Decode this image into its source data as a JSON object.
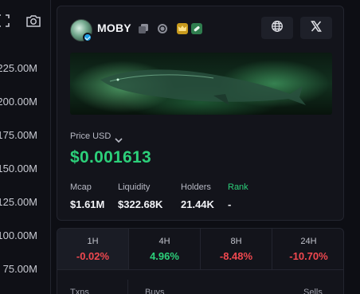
{
  "chart_axis": {
    "labels": [
      "225.00M",
      "200.00M",
      "175.00M",
      "150.00M",
      "125.00M",
      "100.00M",
      "75.00M"
    ]
  },
  "token": {
    "name": "MOBY",
    "price_label": "Price USD",
    "price": "$0.001613",
    "stats": [
      {
        "label": "Mcap",
        "value": "$1.61M"
      },
      {
        "label": "Liquidity",
        "value": "$322.68K"
      },
      {
        "label": "Holders",
        "value": "21.44K"
      },
      {
        "label": "Rank",
        "value": "-"
      }
    ],
    "icons": [
      "copy-icon",
      "search-icon",
      "crown-icon",
      "pill-icon",
      "globe-icon",
      "x-icon"
    ]
  },
  "changes": [
    {
      "period": "1H",
      "value": "-0.02%",
      "direction": "down"
    },
    {
      "period": "4H",
      "value": "4.96%",
      "direction": "up"
    },
    {
      "period": "8H",
      "value": "-8.48%",
      "direction": "down"
    },
    {
      "period": "24H",
      "value": "-10.70%",
      "direction": "down"
    }
  ],
  "txns": {
    "txns_label": "Txns",
    "buys_label": "Buys",
    "sells_label": "Sells"
  },
  "colors": {
    "positive": "#2cd07a",
    "negative": "#f0484f",
    "accent": "#1ea1e8"
  }
}
